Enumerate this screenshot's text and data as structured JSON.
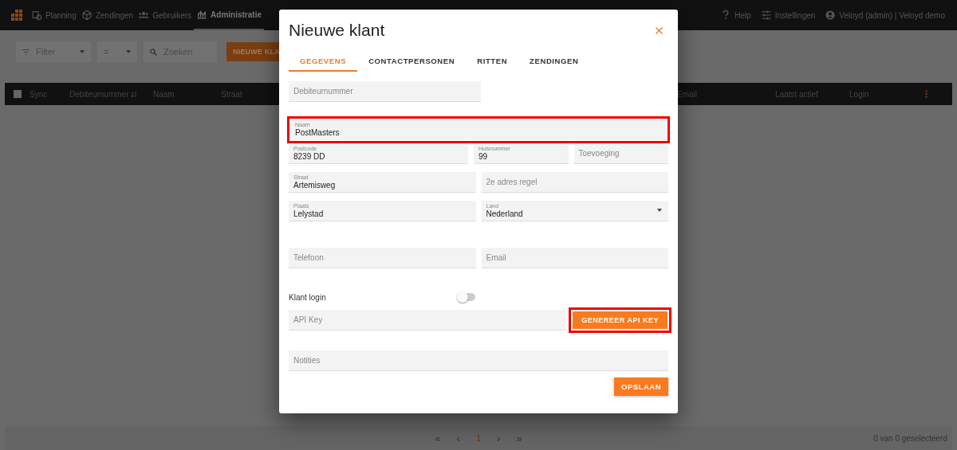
{
  "nav": {
    "items": [
      {
        "label": "Planning",
        "selected": false
      },
      {
        "label": "Zendingen",
        "selected": false
      },
      {
        "label": "Gebruikers",
        "selected": false
      },
      {
        "label": "Administratie",
        "selected": true
      }
    ],
    "right": [
      {
        "label": "Help"
      },
      {
        "label": "Instellingen"
      },
      {
        "label": "Veloyd (admin) | Veloyd demo"
      }
    ]
  },
  "toolbar": {
    "filter": "Filter",
    "operator": "=",
    "search_placeholder": "Zoeken",
    "button": "NIEUWE KLA"
  },
  "table": {
    "select_all_checked": false,
    "columns": [
      "Sync",
      "Debiteurnummer",
      "Naam",
      "Straat",
      "Email",
      "Laatst actief",
      "Login"
    ]
  },
  "pagination": {
    "controls": [
      {
        "label": "«",
        "selected": false
      },
      {
        "label": "‹",
        "selected": false
      },
      {
        "label": "1",
        "selected": true
      },
      {
        "label": "›",
        "selected": false
      },
      {
        "label": "»",
        "selected": false
      }
    ],
    "status": "0 van 0 geselecteerd"
  },
  "modal": {
    "title": "Nieuwe klant",
    "tabs": [
      {
        "label": "GEGEVENS",
        "selected": true
      },
      {
        "label": "CONTACTPERSONEN",
        "selected": false
      },
      {
        "label": "RITTEN",
        "selected": false
      },
      {
        "label": "ZENDINGEN",
        "selected": false
      }
    ],
    "rows": [
      [
        {
          "kind": "text",
          "label": "Debiteurnummer"
        }
      ],
      [
        {
          "kind": "text",
          "label": "Naam",
          "value": "PostMasters",
          "highlighted": true
        }
      ],
      [
        {
          "kind": "text",
          "label": "Postcode",
          "value": "8239 DD"
        },
        {
          "kind": "text",
          "label": "Huisnummer",
          "value": "99"
        },
        {
          "kind": "text",
          "label": "Toevoeging"
        }
      ],
      [
        {
          "kind": "text",
          "label": "Straat",
          "value": "Artemisweg"
        },
        {
          "kind": "text",
          "label": "2e adres regel"
        }
      ],
      [
        {
          "kind": "text",
          "label": "Plaats",
          "value": "Lelystad"
        },
        {
          "kind": "select",
          "label": "Land",
          "value": "Nederland"
        }
      ],
      [
        {
          "kind": "text",
          "label": "Telefoon"
        },
        {
          "kind": "text",
          "label": "Email"
        }
      ]
    ],
    "login": {
      "label": "Klant login",
      "on": false
    },
    "api": {
      "label": "API Key",
      "button": "GENEREER API KEY",
      "highlighted": true
    },
    "notes": {
      "label": "Notities"
    },
    "save": "OPSLAAN"
  }
}
